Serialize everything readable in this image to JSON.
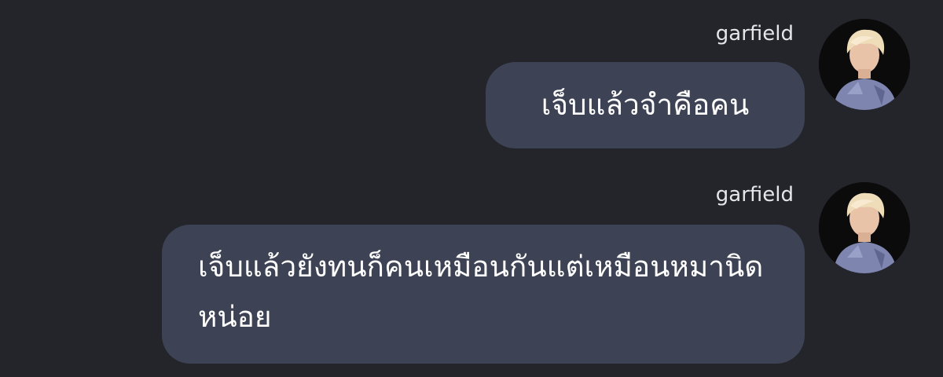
{
  "conversation": {
    "messages": [
      {
        "sender": "garfield",
        "text": "เจ็บแล้วจำคือคน",
        "avatar_icon": "profile-photo"
      },
      {
        "sender": "garfield",
        "text": "เจ็บแล้วยังทนก็คนเหมือนกันแต่เหมือนหมานิดหน่อย",
        "avatar_icon": "profile-photo"
      }
    ]
  },
  "colors": {
    "background": "#24252b",
    "bubble": "#3d4354",
    "text": "#ffffff",
    "sender": "#e6e6e9"
  }
}
